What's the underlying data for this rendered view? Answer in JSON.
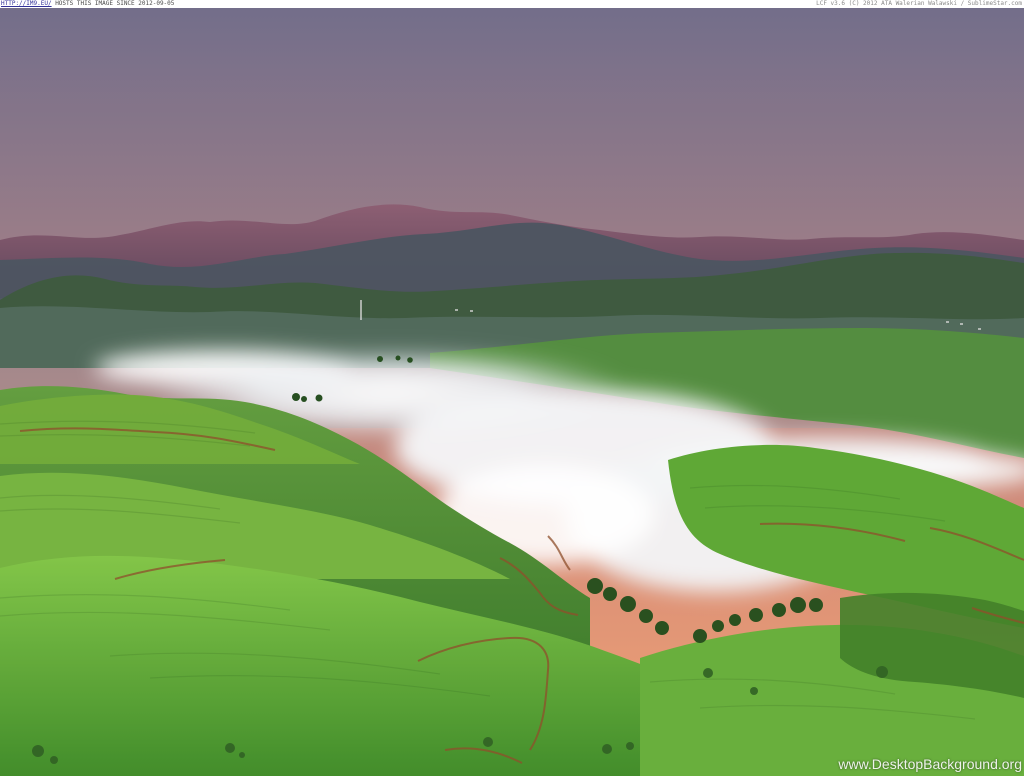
{
  "header": {
    "link_text": "HTTP://IM9.EU/",
    "hosted_text": " HOSTS THIS IMAGE SINCE 2012-09-05",
    "right_text": "LCF v3.6 (C) 2012 ATA Walerian Walawski / SublimeStar.com"
  },
  "photo": {
    "subject": "landscape-photo",
    "colors": {
      "sky_top": "#6f6a87",
      "sky_mid": "#d58a74",
      "sky_bottom": "#f3a06f",
      "far_hills": "#6f4c63",
      "mid_hills": "#3f5046",
      "green_light": "#74b83b",
      "green_dark": "#2d6d20",
      "mist": "#f5f6f8",
      "path": "#8c4a25"
    }
  },
  "watermark": {
    "text": "www.DesktopBackground.org"
  }
}
